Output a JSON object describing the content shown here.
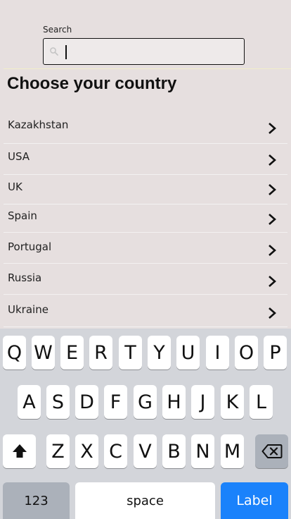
{
  "search": {
    "label": "Search",
    "value": "",
    "placeholder": ""
  },
  "page": {
    "title": "Choose your country"
  },
  "countries": [
    {
      "label": "Kazakhstan"
    },
    {
      "label": "USA"
    },
    {
      "label": "UK"
    },
    {
      "label": "Spain"
    },
    {
      "label": "Portugal"
    },
    {
      "label": "Russia"
    },
    {
      "label": "Ukraine"
    }
  ],
  "keyboard": {
    "row1": [
      "Q",
      "W",
      "E",
      "R",
      "T",
      "Y",
      "U",
      "I",
      "O",
      "P"
    ],
    "row2": [
      "A",
      "S",
      "D",
      "F",
      "G",
      "H",
      "J",
      "K",
      "L"
    ],
    "row3": [
      "Z",
      "X",
      "C",
      "V",
      "B",
      "N",
      "M"
    ],
    "numbers_label": "123",
    "space_label": "space",
    "return_label": "Label",
    "shift_icon": "shift-arrow-icon",
    "delete_icon": "backspace-icon"
  },
  "colors": {
    "background": "#e6dfdf",
    "keyboard": "#d3d5da",
    "accent": "#1a82fb"
  }
}
